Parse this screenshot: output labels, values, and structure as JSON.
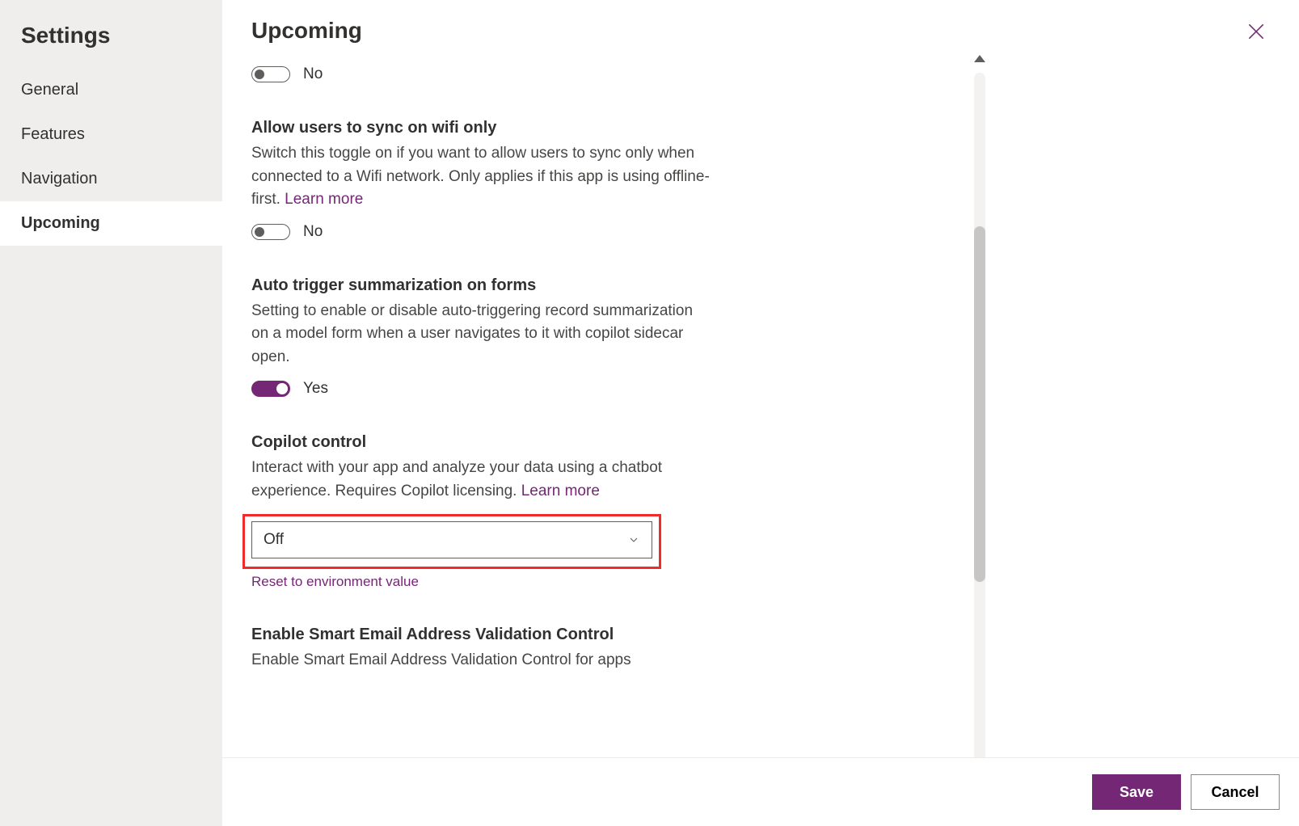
{
  "sidebar": {
    "title": "Settings",
    "items": [
      {
        "label": "General"
      },
      {
        "label": "Features"
      },
      {
        "label": "Navigation"
      },
      {
        "label": "Upcoming"
      }
    ]
  },
  "header": {
    "title": "Upcoming"
  },
  "settings": {
    "s0": {
      "toggle_label": "No"
    },
    "s1": {
      "title": "Allow users to sync on wifi only",
      "desc": "Switch this toggle on if you want to allow users to sync only when connected to a Wifi network. Only applies if this app is using offline-first. ",
      "learn_more": "Learn more",
      "toggle_label": "No"
    },
    "s2": {
      "title": "Auto trigger summarization on forms",
      "desc": "Setting to enable or disable auto-triggering record summarization on a model form when a user navigates to it with copilot sidecar open.",
      "toggle_label": "Yes"
    },
    "s3": {
      "title": "Copilot control",
      "desc": "Interact with your app and analyze your data using a chatbot experience. Requires Copilot licensing. ",
      "learn_more": "Learn more",
      "select_value": "Off",
      "reset": "Reset to environment value"
    },
    "s4": {
      "title": "Enable Smart Email Address Validation Control",
      "desc": "Enable Smart Email Address Validation Control for apps"
    }
  },
  "footer": {
    "save": "Save",
    "cancel": "Cancel"
  }
}
